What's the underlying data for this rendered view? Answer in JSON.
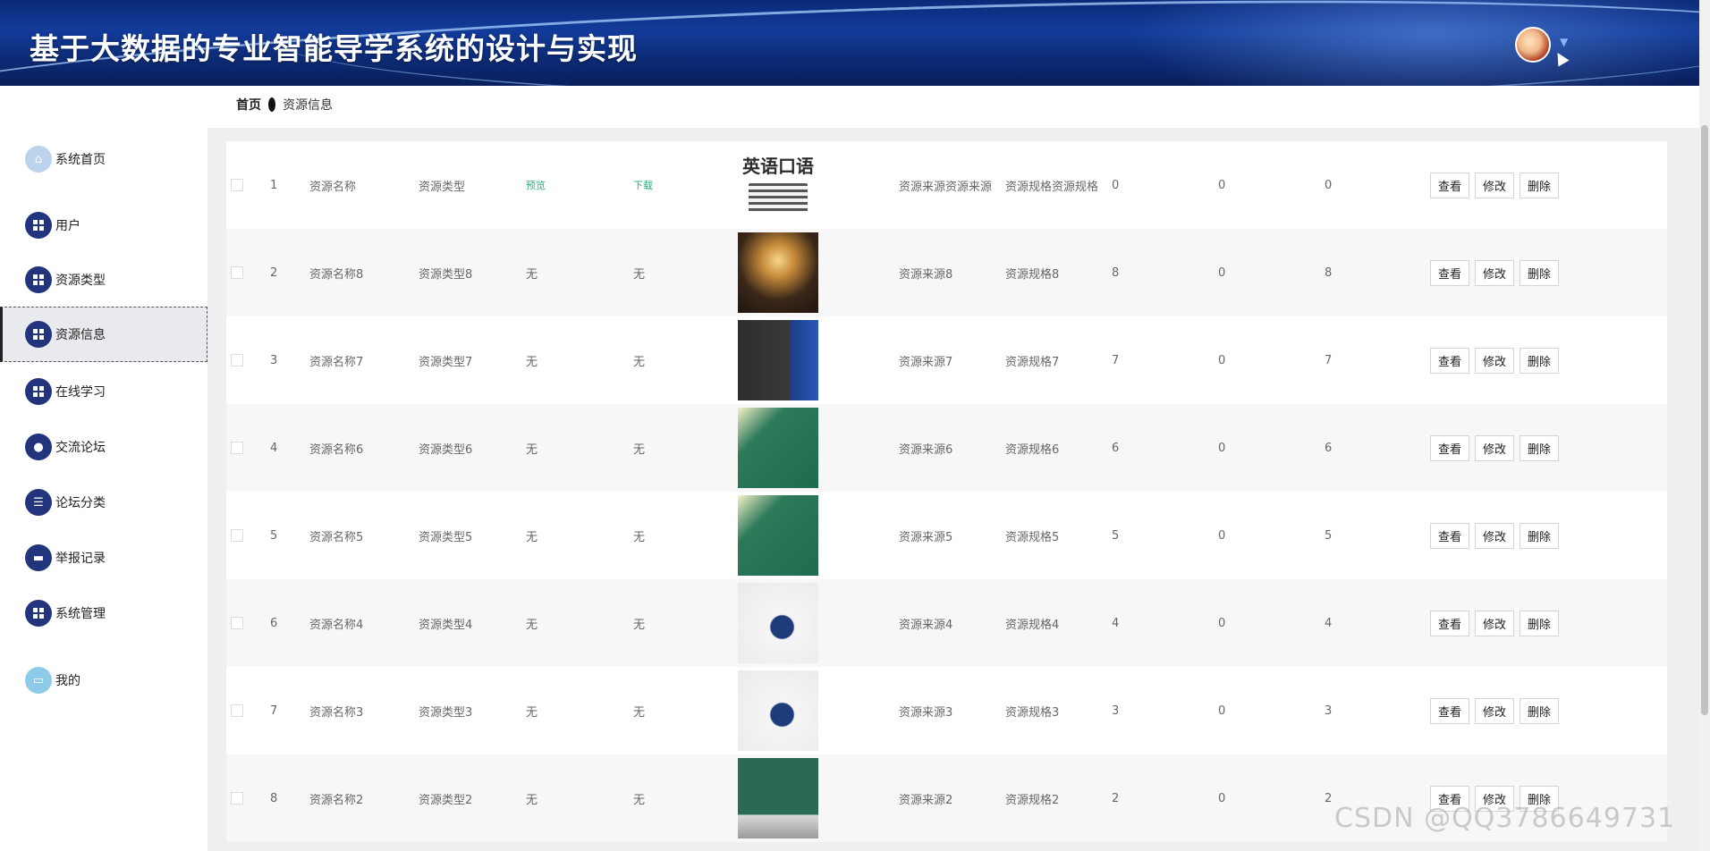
{
  "app": {
    "title": "基于大数据的专业智能导学系统的设计与实现"
  },
  "breadcrumb": {
    "home": "首页",
    "current": "资源信息"
  },
  "sidebar": {
    "items": [
      {
        "label": "系统首页",
        "icon": "home-icon"
      },
      {
        "label": "用户",
        "icon": "grid-icon"
      },
      {
        "label": "资源类型",
        "icon": "grid-icon"
      },
      {
        "label": "资源信息",
        "icon": "grid-icon",
        "active": true
      },
      {
        "label": "在线学习",
        "icon": "grid-icon"
      },
      {
        "label": "交流论坛",
        "icon": "bulb-icon"
      },
      {
        "label": "论坛分类",
        "icon": "list-icon"
      },
      {
        "label": "举报记录",
        "icon": "monitor-icon"
      },
      {
        "label": "系统管理",
        "icon": "grid-icon"
      },
      {
        "label": "我的",
        "icon": "card-icon"
      }
    ]
  },
  "actions": {
    "view": "查看",
    "edit": "修改",
    "delete": "删除"
  },
  "rows": [
    {
      "idx": "1",
      "name": "资源名称",
      "type": "资源类型",
      "preview": "预览",
      "download": "下载",
      "image": "英语口语",
      "source": "资源来源资源来源",
      "spec": "资源规格资源规格",
      "n1": "0",
      "n2": "0",
      "n3": "0"
    },
    {
      "idx": "2",
      "name": "资源名称8",
      "type": "资源类型8",
      "preview": "无",
      "download": "无",
      "image": "",
      "source": "资源来源8",
      "spec": "资源规格8",
      "n1": "8",
      "n2": "0",
      "n3": "8"
    },
    {
      "idx": "3",
      "name": "资源名称7",
      "type": "资源类型7",
      "preview": "无",
      "download": "无",
      "image": "",
      "source": "资源来源7",
      "spec": "资源规格7",
      "n1": "7",
      "n2": "0",
      "n3": "7"
    },
    {
      "idx": "4",
      "name": "资源名称6",
      "type": "资源类型6",
      "preview": "无",
      "download": "无",
      "image": "",
      "source": "资源来源6",
      "spec": "资源规格6",
      "n1": "6",
      "n2": "0",
      "n3": "6"
    },
    {
      "idx": "5",
      "name": "资源名称5",
      "type": "资源类型5",
      "preview": "无",
      "download": "无",
      "image": "",
      "source": "资源来源5",
      "spec": "资源规格5",
      "n1": "5",
      "n2": "0",
      "n3": "5"
    },
    {
      "idx": "6",
      "name": "资源名称4",
      "type": "资源类型4",
      "preview": "无",
      "download": "无",
      "image": "",
      "source": "资源来源4",
      "spec": "资源规格4",
      "n1": "4",
      "n2": "0",
      "n3": "4"
    },
    {
      "idx": "7",
      "name": "资源名称3",
      "type": "资源类型3",
      "preview": "无",
      "download": "无",
      "image": "",
      "source": "资源来源3",
      "spec": "资源规格3",
      "n1": "3",
      "n2": "0",
      "n3": "3"
    },
    {
      "idx": "8",
      "name": "资源名称2",
      "type": "资源类型2",
      "preview": "无",
      "download": "无",
      "image": "",
      "source": "资源来源2",
      "spec": "资源规格2",
      "n1": "2",
      "n2": "0",
      "n3": "2"
    }
  ],
  "watermark": "CSDN @QQ3786649731",
  "colors": {
    "header": "#0b2a78",
    "accent": "#22357c",
    "link": "#2ab07a"
  }
}
